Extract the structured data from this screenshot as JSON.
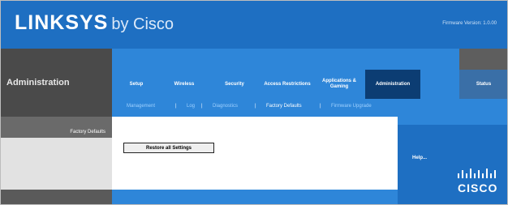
{
  "header": {
    "logo_main": "LINKSYS",
    "logo_sub": "by Cisco",
    "firmware": "Firmware Version: 1.0.00"
  },
  "page_title": "Administration",
  "menu": {
    "items": [
      {
        "label": "Setup"
      },
      {
        "label": "Wireless"
      },
      {
        "label": "Security"
      },
      {
        "label": "Access Restrictions"
      },
      {
        "label": "Applications & Gaming"
      },
      {
        "label": "Administration"
      },
      {
        "label": "Status"
      }
    ],
    "active_index": 5
  },
  "submenu": {
    "items": [
      {
        "label": "Management"
      },
      {
        "label": "Log"
      },
      {
        "label": "Diagnostics"
      },
      {
        "label": "Factory Defaults"
      },
      {
        "label": "Firmware Upgrade"
      }
    ],
    "separator": "|"
  },
  "section": {
    "label": "Factory Defaults",
    "button_label": "Restore all Settings"
  },
  "help": {
    "label": "Help..."
  },
  "brand": {
    "cisco_text": "CISCO"
  },
  "colors": {
    "header_blue": "#1e6fc2",
    "menu_blue": "#2e86d9",
    "active_tab": "#0c3d73",
    "dark_gray": "#4a4a4a"
  }
}
